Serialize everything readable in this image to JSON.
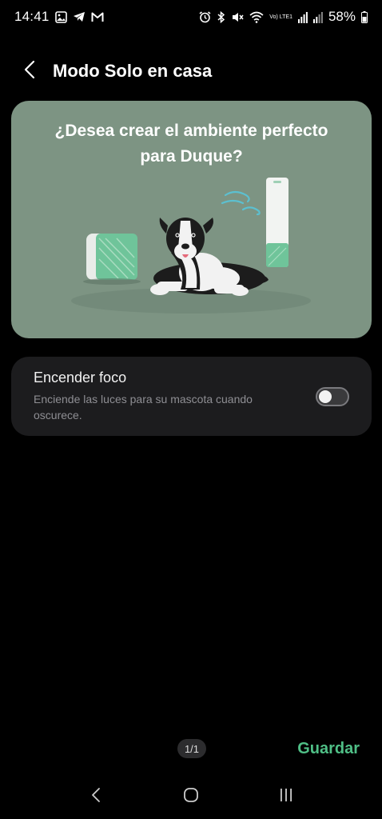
{
  "status_bar": {
    "time": "14:41",
    "lte_label": "Vo) LTE1",
    "battery": "58%"
  },
  "header": {
    "title": "Modo Solo en casa"
  },
  "hero": {
    "title": "¿Desea crear el ambiente perfecto para Duque?",
    "background": "#7d9483"
  },
  "setting": {
    "title": "Encender foco",
    "subtitle": "Enciende las luces para su mascota cuando oscurece.",
    "enabled": false
  },
  "footer": {
    "pager": "1/1",
    "save_label": "Guardar",
    "accent": "#4fbf86"
  },
  "icons": {
    "status_left": [
      "gallery-icon",
      "telegram-icon",
      "gmail-icon"
    ],
    "status_right": [
      "alarm-icon",
      "bluetooth-icon",
      "mute-icon",
      "wifi-icon",
      "signal-icon",
      "signal-icon",
      "battery-icon"
    ],
    "nav": [
      "back-nav-icon",
      "home-nav-icon",
      "recents-nav-icon"
    ]
  }
}
